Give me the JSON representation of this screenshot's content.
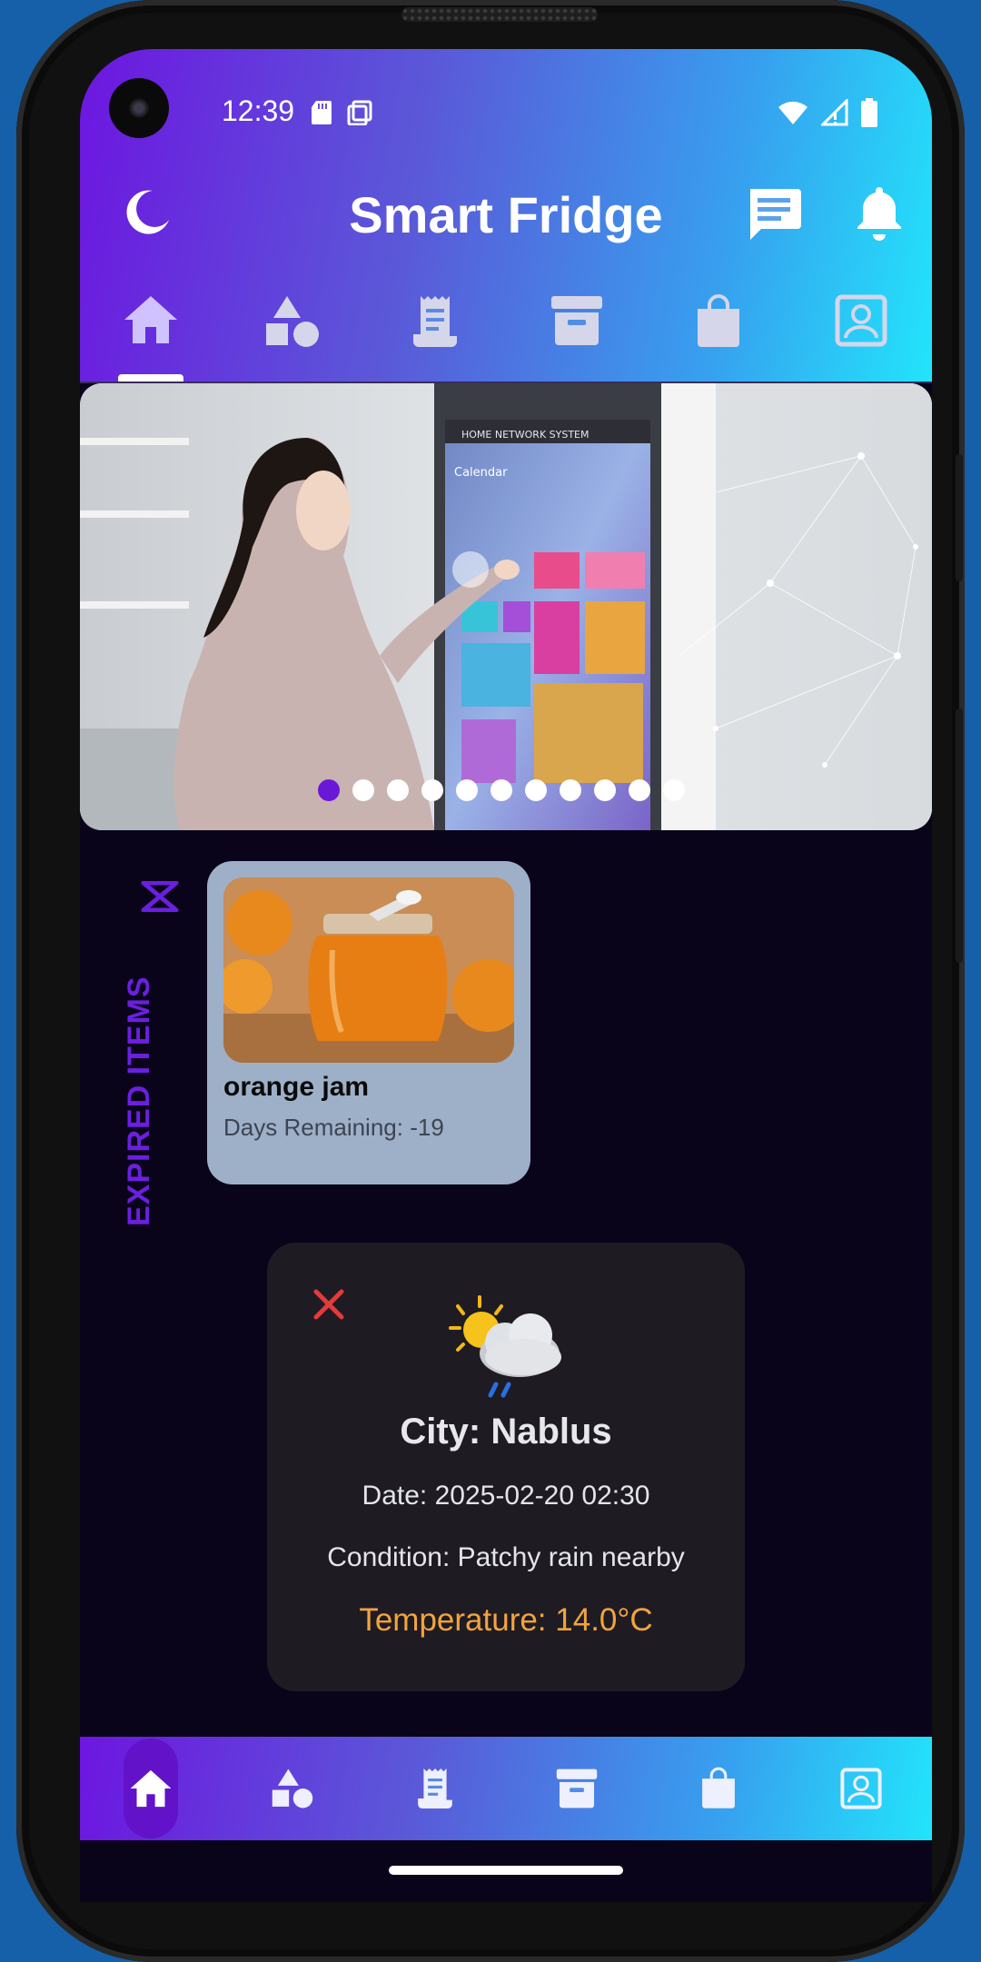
{
  "status_bar": {
    "time": "12:39"
  },
  "app": {
    "title": "Smart Fridge"
  },
  "top_tabs": [
    {
      "icon": "home-icon",
      "active": true
    },
    {
      "icon": "shapes-icon",
      "active": false
    },
    {
      "icon": "receipt-icon",
      "active": false
    },
    {
      "icon": "archive-icon",
      "active": false
    },
    {
      "icon": "shopping-bag-icon",
      "active": false
    },
    {
      "icon": "contact-icon",
      "active": false
    }
  ],
  "banner": {
    "screen_heading": "HOME NETWORK SYSTEM",
    "screen_calendar": "Calendar",
    "slide_count": 11,
    "active_slide": 1
  },
  "expired_section": {
    "label": "EXPIRED ITEMS"
  },
  "expired_items": [
    {
      "name": "orange jam",
      "days_text": "Days Remaining: -19"
    }
  ],
  "weather": {
    "city": "City: Nablus",
    "date": "Date: 2025-02-20 02:30",
    "condition": "Condition: Patchy rain nearby",
    "temperature": "Temperature: 14.0°C",
    "temperature_color": "#f4a33d",
    "icon": "sun-behind-rain-cloud-icon"
  },
  "bottom_nav": [
    {
      "icon": "home-icon",
      "active": true
    },
    {
      "icon": "shapes-icon",
      "active": false
    },
    {
      "icon": "receipt-icon",
      "active": false
    },
    {
      "icon": "archive-icon",
      "active": false
    },
    {
      "icon": "shopping-bag-icon",
      "active": false
    },
    {
      "icon": "contact-icon",
      "active": false
    }
  ],
  "colors": {
    "gradient_start": "#6d16e0",
    "gradient_end": "#22e4fb",
    "screen_background": "#0a041a",
    "accent_purple": "#6b1fe0",
    "card_background": "#9eb0c8"
  }
}
